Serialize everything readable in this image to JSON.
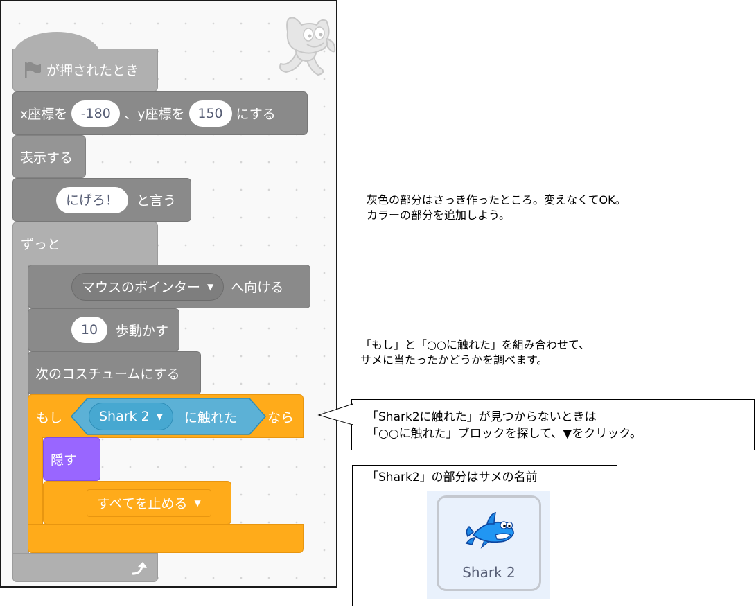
{
  "script": {
    "hat_label": "が押されたとき",
    "goto": {
      "prefix": "x座標を",
      "x": "-180",
      "middle": "、y座標を",
      "y": "150",
      "suffix": "にする"
    },
    "show": "表示する",
    "say": {
      "text": "にげろ！",
      "suffix": "と言う"
    },
    "forever": "ずっと",
    "point": {
      "target": "マウスのポインター",
      "suffix": "へ向ける"
    },
    "move": {
      "steps": "10",
      "suffix": "歩動かす"
    },
    "next_costume": "次のコスチュームにする",
    "if_block": {
      "if_label": "もし",
      "sprite": "Shark 2",
      "touching": "に触れた",
      "then_label": "なら"
    },
    "hide": "隠す",
    "stop": "すべてを止める"
  },
  "notes": {
    "gray_note": [
      "灰色の部分はさっき作ったところ。変えなくてOK。",
      "カラーの部分を追加しよう。"
    ],
    "combine_note": [
      "「もし」と「○○に触れた」を組み合わせて、",
      "サメに当たったかどうかを調べます。"
    ],
    "callout": [
      "「Shark2に触れた」が見つからないときは",
      "「○○に触れた」ブロックを探して、▼をクリック。"
    ],
    "name_note": "「Shark2」の部分はサメの名前",
    "sprite_card_label": "Shark 2"
  },
  "colors": {
    "events_gray": "#b0b0b0",
    "motion_gray": "#8a8a8a",
    "control_orange": "#ffab1a",
    "looks_purple": "#9966ff",
    "sensing_blue": "#5cb1d6"
  },
  "icons": [
    "green-flag-icon",
    "dropdown-triangle-icon",
    "loop-arrow-icon",
    "scratch-cat-icon",
    "shark-icon"
  ]
}
